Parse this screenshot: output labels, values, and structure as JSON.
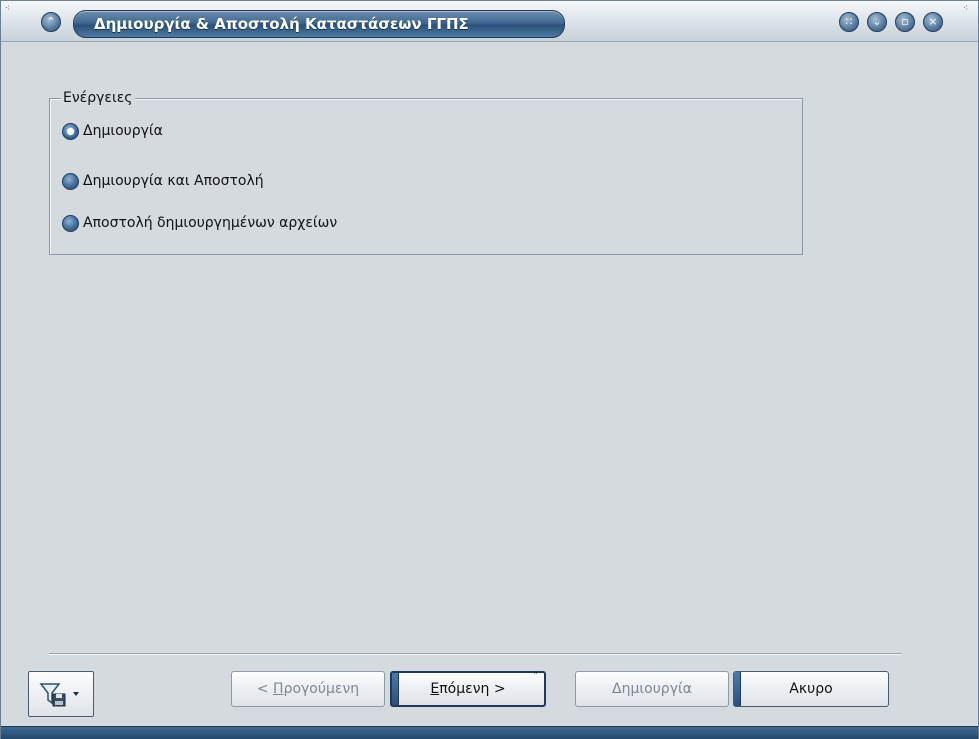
{
  "window": {
    "title": "Δημιουργία & Αποστολή Καταστάσεων ΓΓΠΣ"
  },
  "actions_group": {
    "legend": "Ενέργειες",
    "options": [
      {
        "label": "Δημιουργία",
        "checked": true
      },
      {
        "label": "Δημιουργία και Αποστολή",
        "checked": false
      },
      {
        "label": "Αποστολή δημιουργημένων αρχείων",
        "checked": false
      }
    ]
  },
  "footer": {
    "previous_label_prefix": "< ",
    "previous_label_mnemonic": "Π",
    "previous_label_rest": "ρογούμενη",
    "next_label_mnemonic": "Ε",
    "next_label_rest": "πόμενη >",
    "create_label": "Δημιουργία",
    "cancel_label": "Ακυρο"
  },
  "colors": {
    "accent": "#2c5179",
    "window_bg": "#d5dadf"
  },
  "icons": {
    "filter": "filter-save-icon",
    "dropdown": "chevron-down-icon"
  }
}
